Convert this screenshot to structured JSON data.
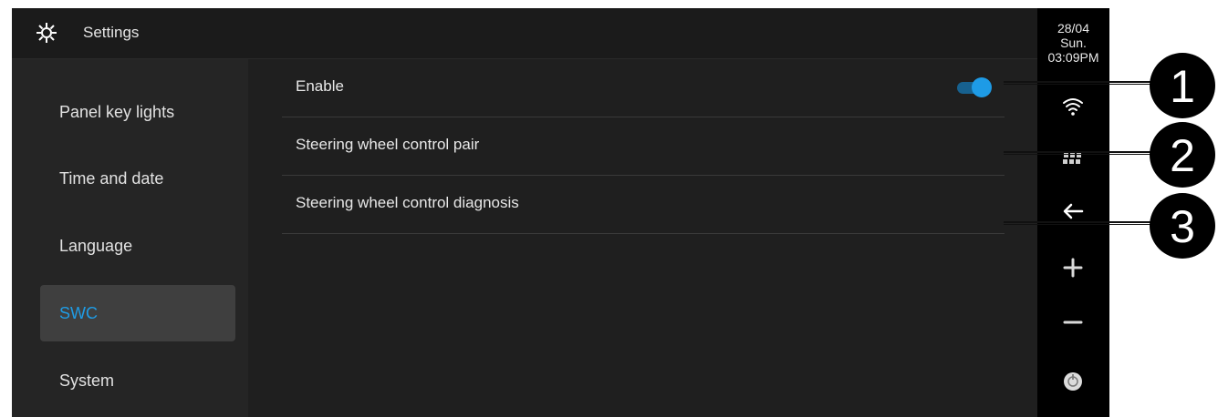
{
  "header": {
    "title": "Settings",
    "icon": "gear-icon"
  },
  "sidebar": {
    "items": [
      {
        "label": "Panel key lights"
      },
      {
        "label": "Time and date"
      },
      {
        "label": "Language"
      },
      {
        "label": "SWC",
        "active": true
      },
      {
        "label": "System"
      }
    ]
  },
  "main": {
    "rows": [
      {
        "label": "Enable",
        "toggle_on": true
      },
      {
        "label": "Steering wheel control pair"
      },
      {
        "label": "Steering wheel control diagnosis"
      }
    ]
  },
  "status": {
    "date": "28/04",
    "day": "Sun.",
    "time": "03:09PM"
  },
  "rail_icons": [
    "wifi-icon",
    "apps-icon",
    "back-icon",
    "volume-up-icon",
    "volume-down-icon",
    "power-icon"
  ],
  "callouts": [
    "1",
    "2",
    "3"
  ],
  "colors": {
    "accent": "#1e9be6",
    "background": "#1f1f1f",
    "sidebar": "#252525"
  }
}
